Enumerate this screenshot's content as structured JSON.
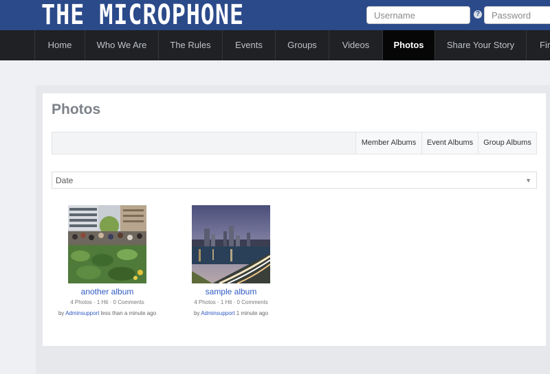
{
  "site": {
    "logo": "THE MICROPHONE"
  },
  "login": {
    "username_placeholder": "Username",
    "password_placeholder": "Password",
    "help_glyph": "?"
  },
  "nav": {
    "items": [
      {
        "label": "Home",
        "active": false
      },
      {
        "label": "Who We Are",
        "active": false
      },
      {
        "label": "The Rules",
        "active": false
      },
      {
        "label": "Events",
        "active": false
      },
      {
        "label": "Groups",
        "active": false
      },
      {
        "label": "Videos",
        "active": false
      },
      {
        "label": "Photos",
        "active": true
      },
      {
        "label": "Share Your Story",
        "active": false
      },
      {
        "label": "Fin",
        "active": false
      }
    ]
  },
  "page": {
    "title": "Photos"
  },
  "tabs": [
    "Member Albums",
    "Event Albums",
    "Group Albums"
  ],
  "sort": {
    "selected": "Date",
    "caret": "▼"
  },
  "albums": [
    {
      "title": "another album",
      "meta": "4 Photos · 1 Hit · 0 Comments",
      "by_prefix": "by",
      "author": "Adminsupport",
      "time": "less than a minute ago",
      "thumb": "crowd-in-plaza-photo"
    },
    {
      "title": "sample album",
      "meta": "4 Photos · 1 Hit · 0 Comments",
      "by_prefix": "by",
      "author": "Adminsupport",
      "time": "1 minute ago",
      "thumb": "city-skyline-night-photo"
    }
  ],
  "colors": {
    "header": "#2b4a8a",
    "nav": "#1f2124",
    "nav_active": "#060606",
    "link": "#2e59c2"
  }
}
